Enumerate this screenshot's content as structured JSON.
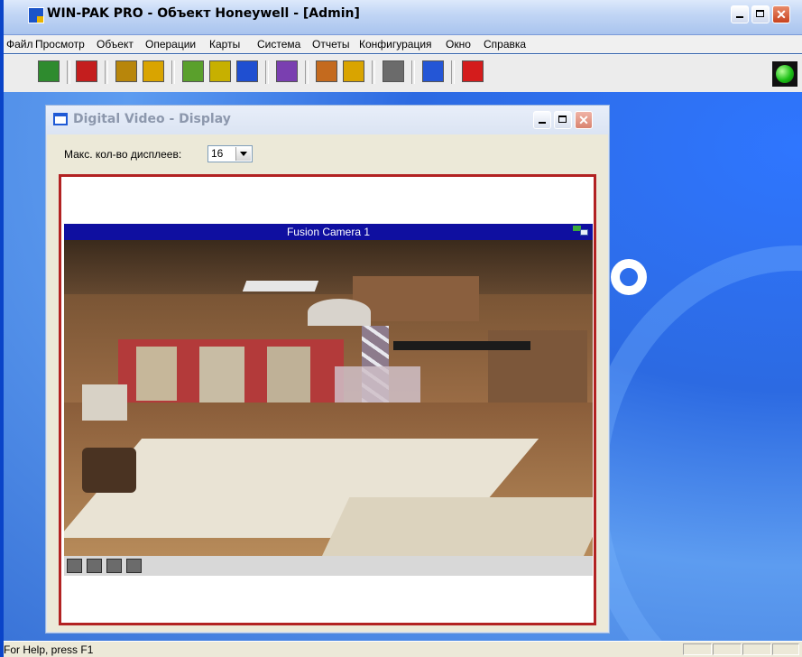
{
  "window": {
    "title": "WIN-PAK PRO - Объект Honeywell - [Admin]",
    "minimize_label": "",
    "maximize_label": "",
    "close_label": "✕"
  },
  "menu": [
    "Файл",
    "Просмотр",
    "Объект",
    "Операции",
    "Карты",
    "Система",
    "Отчеты",
    "Конфигурация",
    "Окно",
    "Справка"
  ],
  "toolbar": {
    "buttons": [
      {
        "icon": "checklist-icon",
        "color": "#2e8b2e"
      },
      {
        "icon": "building-icon",
        "color": "#c41e1e"
      },
      {
        "icon": "panel-icon",
        "color": "#b8860b"
      },
      {
        "icon": "edit-pencil-icon",
        "color": "#d9a400"
      },
      {
        "icon": "map-icon",
        "color": "#5aa02c"
      },
      {
        "icon": "monitor-icon",
        "color": "#c7b000"
      },
      {
        "icon": "report-chart-icon",
        "color": "#1f4fd1"
      },
      {
        "icon": "users-icon",
        "color": "#7a3fb0"
      },
      {
        "icon": "import-export-icon",
        "color": "#c46a1e"
      },
      {
        "icon": "person-icon",
        "color": "#d9a400"
      },
      {
        "icon": "layers-icon",
        "color": "#6b6b6b"
      },
      {
        "icon": "help-icon",
        "color": "#2456d6"
      },
      {
        "icon": "exit-icon",
        "color": "#d41c1c"
      }
    ],
    "status_led_color": "#1bbf15"
  },
  "dv_window": {
    "title": "Digital Video - Display",
    "max_displays_label": "Макс. кол-во дисплеев:",
    "max_displays_value": "16",
    "camera_title": "Fusion Camera 1",
    "frame_color": "#b22222",
    "camera_header_color": "#0f0fa0"
  },
  "status": {
    "text": "For Help, press F1"
  }
}
